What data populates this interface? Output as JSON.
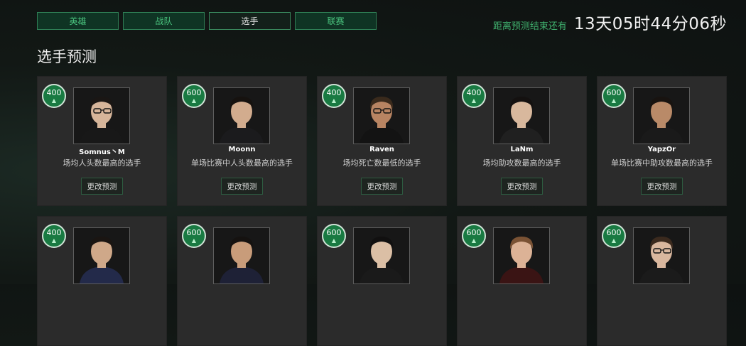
{
  "tabs": [
    "英雄",
    "战队",
    "选手",
    "联赛"
  ],
  "active_tab": 2,
  "countdown": {
    "label": "距离预测结束还有",
    "time": "13天05时44分06秒"
  },
  "page_title": "选手预测",
  "colors": {
    "accent_green": "#4bc57f",
    "badge_green": "#197a42",
    "card_bg": "#2b2b2b"
  },
  "cards": [
    {
      "points": "400",
      "name": "Somnus丶M",
      "desc": "场均人头数最高的选手",
      "button": "更改预测",
      "skin": "#d6b59a",
      "hair": "#1a1614",
      "shirt": "#181818",
      "glasses": true
    },
    {
      "points": "600",
      "name": "Moonn",
      "desc": "单场比赛中人头数最高的选手",
      "button": "更改预测",
      "skin": "#d2ac8e",
      "hair": "#16120f",
      "shirt": "#1b1b1d",
      "glasses": false
    },
    {
      "points": "400",
      "name": "Raven",
      "desc": "场均死亡数最低的选手",
      "button": "更改预测",
      "skin": "#b88462",
      "hair": "#3a2a1c",
      "shirt": "#131313",
      "glasses": true
    },
    {
      "points": "400",
      "name": "LaNm",
      "desc": "场均助攻数最高的选手",
      "button": "更改预测",
      "skin": "#d8b89d",
      "hair": "#141110",
      "shirt": "#202020",
      "glasses": false
    },
    {
      "points": "600",
      "name": "YapzOr",
      "desc": "单场比赛中助攻数最高的选手",
      "button": "更改预测",
      "skin": "#b98a68",
      "hair": "#181310",
      "shirt": "#1a1a1a",
      "glasses": false
    },
    {
      "points": "400",
      "name": "",
      "desc": "",
      "button": "",
      "skin": "#cfa889",
      "hair": "#1a1512",
      "shirt": "#232a4a",
      "glasses": false
    },
    {
      "points": "600",
      "name": "",
      "desc": "",
      "button": "",
      "skin": "#c89c7a",
      "hair": "#151210",
      "shirt": "#1e2136",
      "glasses": false
    },
    {
      "points": "600",
      "name": "",
      "desc": "",
      "button": "",
      "skin": "#dbbfa5",
      "hair": "#111010",
      "shirt": "#1a1a1a",
      "glasses": false
    },
    {
      "points": "600",
      "name": "",
      "desc": "",
      "button": "",
      "skin": "#dcb296",
      "hair": "#7a5234",
      "shirt": "#3a1414",
      "glasses": false
    },
    {
      "points": "600",
      "name": "",
      "desc": "",
      "button": "",
      "skin": "#d9b79e",
      "hair": "#3b2a1e",
      "shirt": "#1b1b1b",
      "glasses": true
    }
  ]
}
